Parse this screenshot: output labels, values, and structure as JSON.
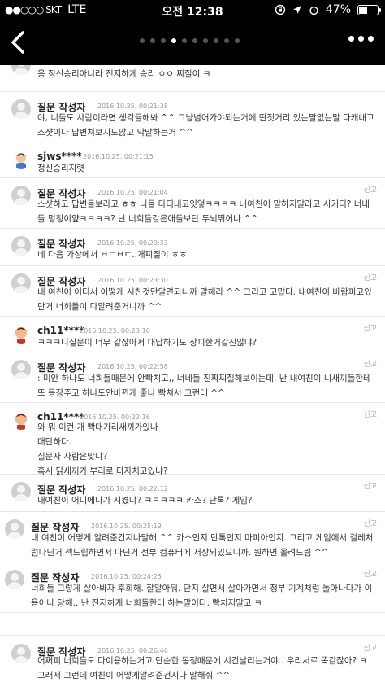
{
  "status_bar": {
    "carrier": "●●○○○ SKT",
    "network": "LTE",
    "time": "오전 12:38",
    "battery": "47%",
    "battery_level": 0.47
  },
  "nav": {
    "back_icon": "chevron-left-icon",
    "more_icon": "more-horizontal-icon",
    "pager_count": 10,
    "pager_active": 3
  },
  "top_fragment": {
    "text": "응 정신승리아니라 진지하게 승리 ㅇㅇ 찌질이 ㅋ"
  },
  "comments": [
    {
      "author": "질문 작성자",
      "date": "2016.10.25. 00:21:38",
      "report": "",
      "text": "야, 니들도 사람이라면 생각들해봐 ^^ 그냥넘어가야되는거에 딴짓거리 있는말없는말 다캐내고 스샷이나 답변쳐보지도않고 막말하는거 ^^"
    },
    {
      "author": "sjws****",
      "date": "2016.10.25. 00:21:15",
      "report": "",
      "text": "정신승리지렷"
    },
    {
      "author": "질문 작성자",
      "date": "2016.10.25. 00:21:04",
      "report": "신고",
      "text": "스샷하고 답변들보라고 ㅎㅎ 니들 다티내고잇엏ㅋㅋㅋㅋ 내여친이 말하지말라고 시키디? 너네들 멍청이얖ㅋㅋㅋㅋ? 난 너희들같은애들보단 두뇌뛰어나 ^^"
    },
    {
      "author": "질문 작성자",
      "date": "2016.10.25. 00:20:33",
      "report": "",
      "text": "네 다음 가상에서 ㅂㄷㅂㄷ..개찌질이 ㅎㅎ"
    },
    {
      "author": "질문 작성자",
      "date": "2016.10.25. 00:23:30",
      "report": "신고",
      "text": "내 여친이 어디서 어떻게 시친것만알면되니까 말해라 ^^ 그리고 고맙다. 내여친이 바람피고있단거 너희들이 다알려준거니까 ^^"
    },
    {
      "author": "ch11****",
      "date": "2016.10.25. 00:23:10",
      "report": "신고",
      "text": "ㅋㅋㅋ니질문이 너무 같잖아서 대답하기도 장피한거같진않냐?"
    },
    {
      "author": "질문 작성자",
      "date": "2016.10.25. 00:22:58",
      "report": "신고",
      "text": ": 미안 하나도 너희들때문에 안빡치고,, 너네들 진짜찌질해보이는데. 난 내여친이 니새끼들한테 또 등장주고 하나도안바뀐게 좋나 빡쳐서 그런데 ^^"
    },
    {
      "author": "ch11****",
      "date": "2016.10.25. 00:22:16",
      "report": "신고",
      "text": "와 뭐 이런 개 빡대가리새끼가있나\n대단하다.\n질문자 사람은맞냐?\n혹시 닭새끼가 부리로 타자치고있냐?"
    },
    {
      "author": "질문 작성자",
      "date": "2016.10.25. 00:22:12",
      "report": "신고",
      "text": "내여친이 어디에다가 시켰냐? ㅋㅋㅋㅋㅋ 카스? 단톡? 게임?"
    },
    {
      "author": "질문 작성자",
      "date": "2016.10.25. 00:25:19",
      "report": "신고",
      "text": "내 여친이 어떻게 알려준건지나말해 ^^ 카스인지 단톡인지 마피아인지. 그리고 게임에서 걸레처럼다닌거 섹드립하면서 다닌거 전부 컴퓨터에 저장되있으니까. 원하면 올려드림 ^^"
    },
    {
      "author": "질문 작성자",
      "date": "2016.10.25. 00:24:25",
      "report": "신고",
      "text": "너희들 그렇게 살아봐자 후회해. 잘알아둬. 단지 살면서 살아가면서 정부 기계처럼 놀아나다가 이용이나 당해.. 난 진지하게 너희들한테 하는말이다. 빡치지말고 ㅋ"
    },
    {
      "author": "질문 작성자",
      "date": "2016.10.25. 00:26:46",
      "report": "신고",
      "text": "어쩌피 너희들도 다이용하는거고 단순한 동정때문에 시간날리는거야.. 우리서로 똑같잖아? ㅋ 그래서 그런데 여친이 어떻게알려준건지나 말해줘 ^^"
    }
  ],
  "colors": {
    "bar_bg": "#000000",
    "page_bg": "#ffffff",
    "text": "#333333",
    "meta": "#999999"
  }
}
